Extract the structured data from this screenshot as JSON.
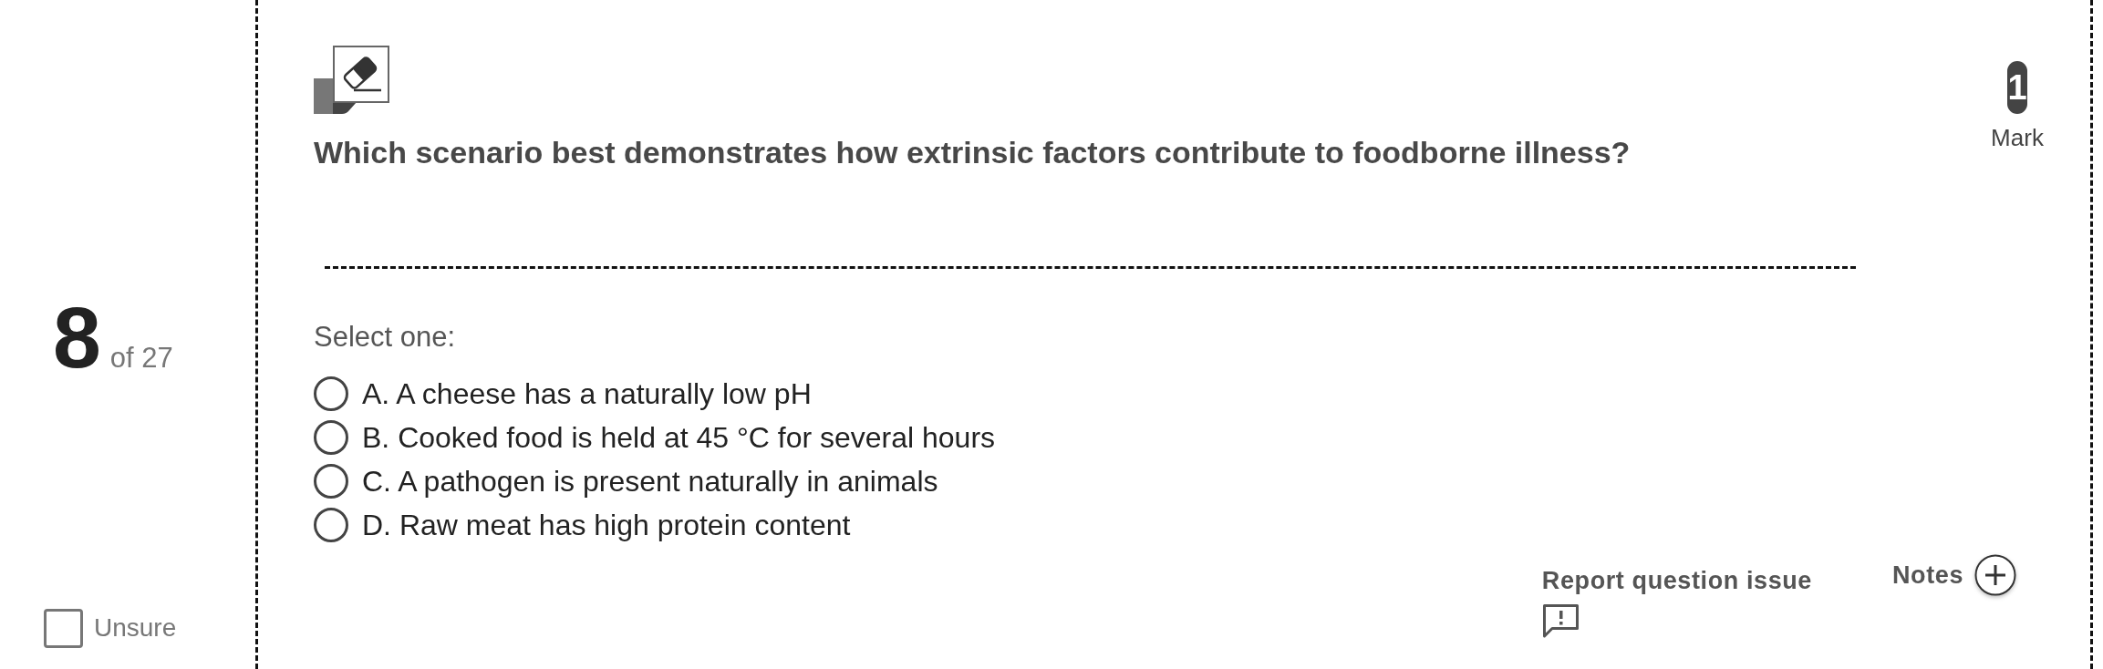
{
  "question_counter": {
    "number": "8",
    "of_total": "of 27"
  },
  "unsure": {
    "label": "Unsure",
    "checked": false
  },
  "question": {
    "text": "Which scenario best demonstrates how extrinsic factors contribute to foodborne illness?",
    "marks": {
      "value": "1",
      "label": "Mark"
    }
  },
  "answer": {
    "prompt": "Select one:",
    "options": [
      {
        "label": "A. A cheese has a naturally low pH",
        "selected": false
      },
      {
        "label": "B. Cooked food is held at 45 °C for several hours",
        "selected": false
      },
      {
        "label": "C. A pathogen is present naturally in animals",
        "selected": false
      },
      {
        "label": "D. Raw meat has high protein content",
        "selected": false
      }
    ]
  },
  "actions": {
    "report": "Report question issue",
    "notes": "Notes"
  }
}
